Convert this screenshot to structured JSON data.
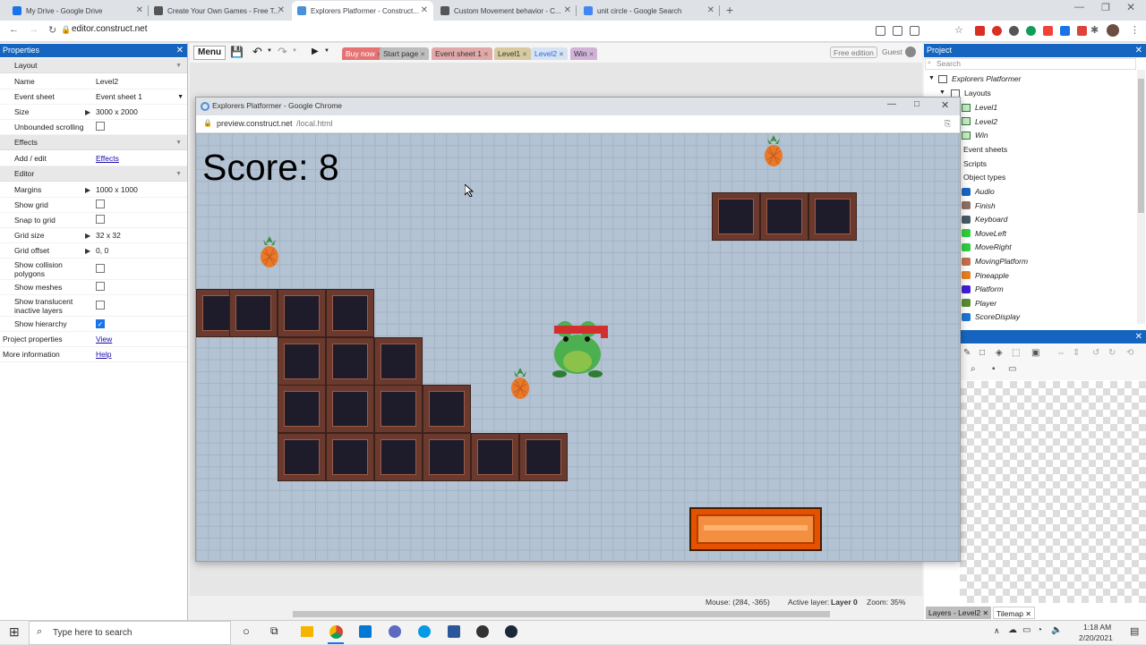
{
  "browser": {
    "tabs": [
      {
        "title": "My Drive - Google Drive",
        "color": "#1a73e8"
      },
      {
        "title": "Create Your Own Games - Free T...",
        "color": "#555"
      },
      {
        "title": "Explorers Platformer - Construct...",
        "color": "#4a90d9"
      },
      {
        "title": "Custom Movement behavior - C...",
        "color": "#555"
      },
      {
        "title": "unit circle - Google Search",
        "color": "#4285f4"
      }
    ],
    "url": "editor.construct.net"
  },
  "editor": {
    "properties_title": "Properties",
    "props": [
      {
        "type": "section",
        "key": "Layout"
      },
      {
        "key": "Name",
        "value": "Level2"
      },
      {
        "key": "Event sheet",
        "value": "Event sheet 1",
        "dropdown": true
      },
      {
        "key": "Size",
        "value": "3000 x 2000",
        "expand": true
      },
      {
        "key": "Unbounded scrolling",
        "check": false
      },
      {
        "type": "section",
        "key": "Effects"
      },
      {
        "key": "Add / edit",
        "link": "Effects"
      },
      {
        "type": "section",
        "key": "Editor"
      },
      {
        "key": "Margins",
        "value": "1000 x 1000",
        "expand": true
      },
      {
        "key": "Show grid",
        "check": false
      },
      {
        "key": "Snap to grid",
        "check": false
      },
      {
        "key": "Grid size",
        "value": "32 x 32",
        "expand": true
      },
      {
        "key": "Grid offset",
        "value": "0, 0",
        "expand": true
      },
      {
        "key": "Show collision polygons",
        "check": false,
        "tall": true
      },
      {
        "key": "Show meshes",
        "check": false
      },
      {
        "key": "Show translucent inactive layers",
        "check": false,
        "tall": true
      },
      {
        "key": "Show hierarchy",
        "check": true
      },
      {
        "type": "top",
        "key": "Project properties",
        "link": "View"
      },
      {
        "type": "top",
        "key": "More information",
        "link": "Help"
      }
    ],
    "toolbar": {
      "menu": "Menu",
      "tabs": [
        {
          "label": "Buy now",
          "bg": "#e57373",
          "fg": "#fff"
        },
        {
          "label": "Start page",
          "bg": "#bdbdbd",
          "fg": "#333"
        },
        {
          "label": "Event sheet 1",
          "bg": "#e0a8a8",
          "fg": "#333"
        },
        {
          "label": "Level1",
          "bg": "#d7c9a0",
          "fg": "#333"
        },
        {
          "label": "Level2",
          "bg": "#d5e3f5",
          "fg": "#3367d6"
        },
        {
          "label": "Win",
          "bg": "#d1b3d8",
          "fg": "#333"
        }
      ],
      "free_edition": "Free edition",
      "guest": "Guest"
    },
    "project": {
      "title": "Project",
      "search_placeholder": "Search",
      "root": "Explorers Platformer",
      "layouts_folder": "Layouts",
      "layouts": [
        "Level1",
        "Level2",
        "Win"
      ],
      "event_sheets": "Event sheets",
      "scripts": "Scripts",
      "object_types": "Object types",
      "objects": [
        {
          "name": "Audio",
          "color": "#1565c0"
        },
        {
          "name": "Finish",
          "color": "#8d6e63"
        },
        {
          "name": "Keyboard",
          "color": "#455a64"
        },
        {
          "name": "MoveLeft",
          "color": "#2ecc40"
        },
        {
          "name": "MoveRight",
          "color": "#2ecc40"
        },
        {
          "name": "MovingPlatform",
          "color": "#c0704d"
        },
        {
          "name": "Pineapple",
          "color": "#e67e22"
        },
        {
          "name": "Platform",
          "color": "#3f1fd6"
        },
        {
          "name": "Player",
          "color": "#558b2f"
        },
        {
          "name": "ScoreDisplay",
          "color": "#1976d2"
        }
      ]
    },
    "status": {
      "mouse": "Mouse: (284, -365)",
      "active_layer_label": "Active layer:",
      "active_layer": "Layer 0",
      "zoom": "Zoom: 35%"
    },
    "bottom_tabs": [
      "Layers - Level2",
      "Tilemap"
    ]
  },
  "preview": {
    "title": "Explorers Platformer - Google Chrome",
    "url_host": "preview.construct.net",
    "url_path": "/local.html",
    "score": "Score: 8"
  },
  "taskbar": {
    "search_placeholder": "Type here to search",
    "time": "1:18 AM",
    "date": "2/20/2021"
  }
}
